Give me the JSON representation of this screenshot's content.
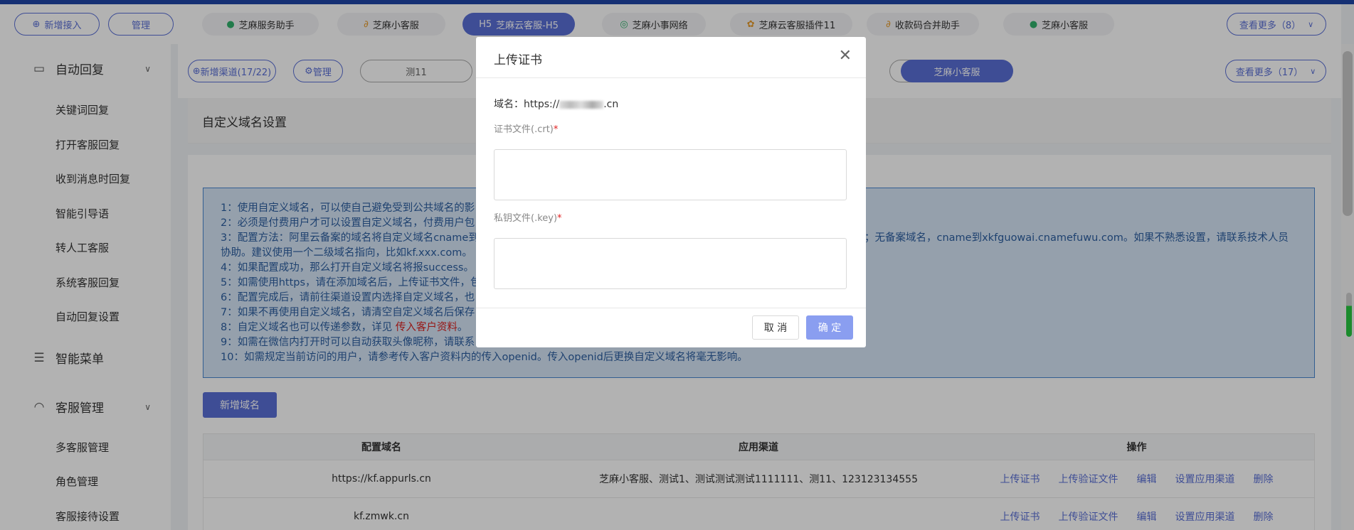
{
  "topbar": {
    "add_label": "新增接入",
    "manage_label": "管理",
    "channels": [
      {
        "label": "芝麻服务助手",
        "icon": "wechat-icon"
      },
      {
        "label": "芝麻小客服",
        "icon": "link-icon"
      },
      {
        "label": "芝麻云客服-H5",
        "prefix": "H5",
        "active": true
      },
      {
        "label": "芝麻小事网络",
        "icon": "whatsapp-icon"
      },
      {
        "label": "芝麻云客服插件11",
        "icon": "plugin-icon"
      },
      {
        "label": "收款码合并助手",
        "icon": "link-icon"
      },
      {
        "label": "芝麻小客服",
        "icon": "wechat-icon"
      }
    ],
    "more_label": "查看更多（8）"
  },
  "sidebar": {
    "sections": [
      {
        "label": "自动回复",
        "icon": "chat-icon",
        "items": [
          "关键词回复",
          "打开客服回复",
          "收到消息时回复",
          "智能引导语",
          "转人工客服",
          "系统客服回复",
          "自动回复设置"
        ]
      },
      {
        "label": "智能菜单",
        "icon": "list-icon",
        "items": []
      },
      {
        "label": "客服管理",
        "icon": "headset-icon",
        "items": [
          "多客服管理",
          "角色管理",
          "客服接待设置"
        ]
      }
    ]
  },
  "subbar": {
    "add_channel_label": "新增渠道(17/22)",
    "manage_label": "管理",
    "tab1": "测11",
    "active_tab": "芝麻小客服",
    "more_label": "查看更多（17）"
  },
  "page": {
    "title": "自定义域名设置",
    "notice": [
      "1：使用自定义域名，可以使自己避免受到公共域名的影",
      "2：必须是付费用户才可以设置自定义域名，付费用户包",
      "3：配置方法：阿里云备案的域名将自定义域名cname到",
      "om；无备案域名，cname到xkfguowai.cnamefuwu.com。如果不熟悉设置，请联系技术人员",
      "协助。建议使用一个二级域名指向，比如kf.xxx.com。",
      "4：如果配置成功，那么打开自定义域名将报success。",
      "5：如需使用https，请在添加域名后，上传证书文件，包",
      "6：配置完成后，请前往渠道设置内选择自定义域名，也",
      "7：如果不再使用自定义域名，请清空自定义域名后保存",
      "8：自定义域名也可以传递参数，详见",
      "传入客户资料",
      "。",
      "9：如需在微信内打开时可以自动获取头像昵称，请联系",
      "10：如需规定当前访问的用户，请参考传入客户资料内的传入openid。传入openid后更换自定义域名将毫无影响。"
    ],
    "add_domain_label": "新增域名",
    "table": {
      "headers": [
        "配置域名",
        "应用渠道",
        "操作"
      ],
      "rows": [
        {
          "domain": "https://kf.appurls.cn",
          "channels": "芝麻小客服、测试1、测试测试测试1111111、测11、123123134555"
        },
        {
          "domain": "kf.zmwk.cn",
          "channels": ""
        }
      ],
      "ops": [
        "上传证书",
        "上传验证文件",
        "编辑",
        "设置应用渠道",
        "删除"
      ]
    }
  },
  "modal": {
    "title": "上传证书",
    "domain_prefix": "域名：https://",
    "domain_suffix": ".cn",
    "cert_label": "证书文件(.crt)",
    "key_label": "私钥文件(.key)",
    "required_mark": "*",
    "cert_value": "",
    "key_value": "",
    "cancel_label": "取 消",
    "ok_label": "确 定"
  }
}
